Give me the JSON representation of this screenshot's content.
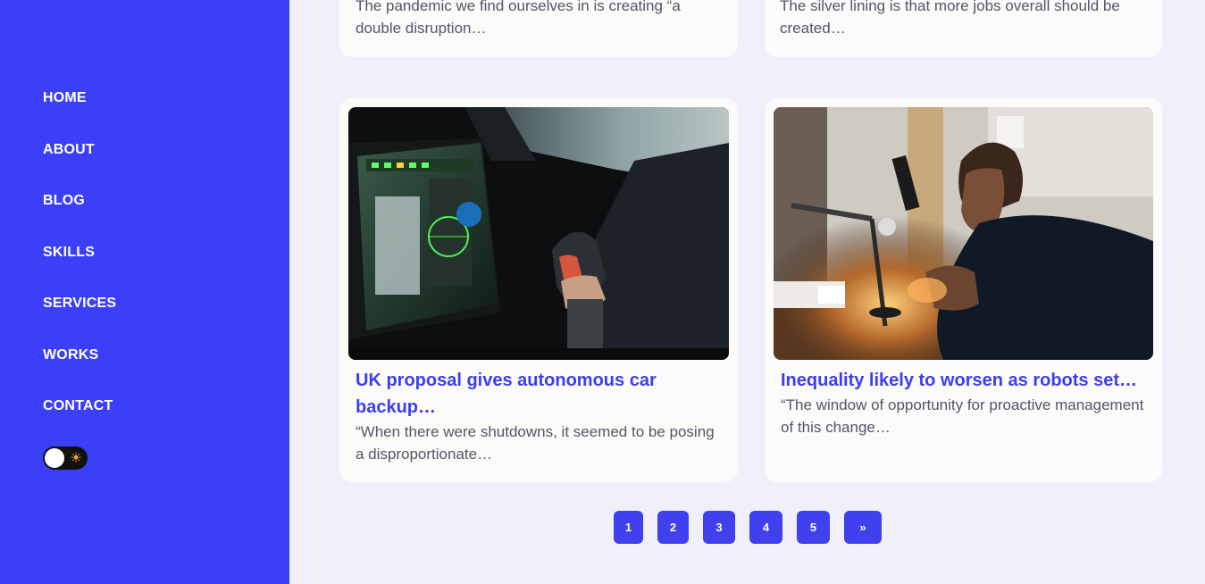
{
  "sidebar": {
    "nav": [
      "HOME",
      "ABOUT",
      "BLOG",
      "SKILLS",
      "SERVICES",
      "WORKS",
      "CONTACT"
    ],
    "theme_toggle": {
      "icon": "sun-icon",
      "state": "light"
    }
  },
  "top_cards": [
    {
      "excerpt": "The pandemic we find ourselves in is creating “a double disruption…"
    },
    {
      "excerpt": "The silver lining is that more jobs overall should be created…"
    }
  ],
  "cards": [
    {
      "image": "cockpit-flight-simulator-image",
      "title": "UK proposal gives autonomous car backup…",
      "excerpt": "“When there were shutdowns, it seemed to be posing a disproportionate…"
    },
    {
      "image": "engineer-at-workbench-image",
      "title": "Inequality likely to worsen as robots set…",
      "excerpt": "“The window of opportunity for proactive management of this change…"
    }
  ],
  "pagination": {
    "pages": [
      "1",
      "2",
      "3",
      "4",
      "5"
    ],
    "next_label": "»"
  },
  "colors": {
    "sidebar": "#3b3ff8",
    "page_bg": "#f0f0fb",
    "card_bg": "#fdfafa",
    "accent": "#3c3ff0",
    "pager": "#4040ee"
  }
}
